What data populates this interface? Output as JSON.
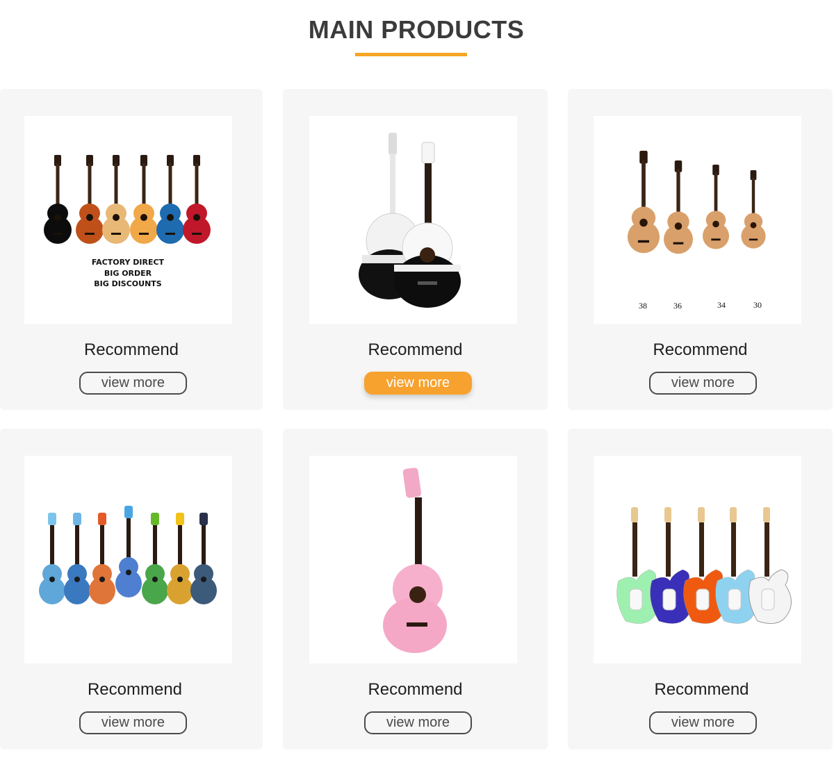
{
  "section": {
    "title": "MAIN PRODUCTS",
    "accent_color": "#f5a623"
  },
  "products": [
    {
      "title": "Recommend",
      "button": "view more",
      "active": false,
      "image_icon": "acoustic-guitars-six-colors",
      "image_text": [
        "FACTORY DIRECT",
        "BIG ORDER",
        "BIG DISCOUNTS"
      ]
    },
    {
      "title": "Recommend",
      "button": "view more",
      "active": true,
      "image_icon": "black-white-acoustic-guitars"
    },
    {
      "title": "Recommend",
      "button": "view more",
      "active": false,
      "image_icon": "natural-acoustic-guitars-sizes",
      "image_text": [
        "38",
        "36",
        "34",
        "30"
      ]
    },
    {
      "title": "Recommend",
      "button": "view more",
      "active": false,
      "image_icon": "painted-ukuleles"
    },
    {
      "title": "Recommend",
      "button": "view more",
      "active": false,
      "image_icon": "pink-classical-guitar"
    },
    {
      "title": "Recommend",
      "button": "view more",
      "active": false,
      "image_icon": "electric-guitars-five-colors"
    }
  ]
}
